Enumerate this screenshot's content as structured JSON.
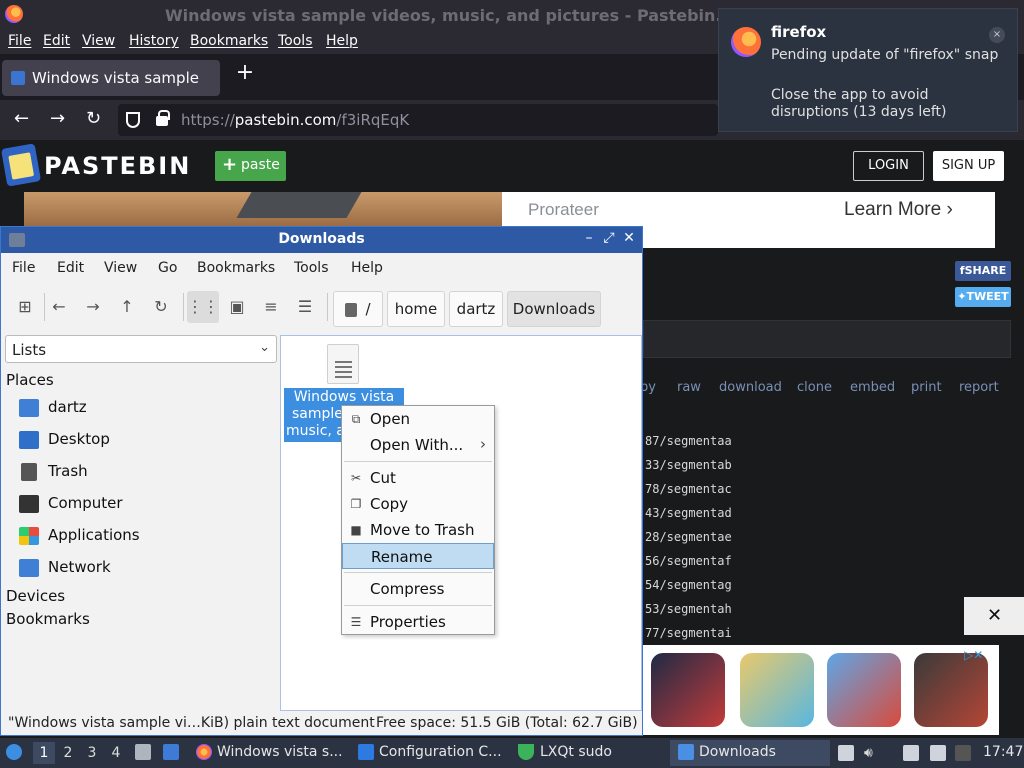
{
  "firefox": {
    "window_title": "Windows vista sample videos, music, and pictures - Pastebin.com",
    "menu": [
      "File",
      "Edit",
      "View",
      "History",
      "Bookmarks",
      "Tools",
      "Help"
    ],
    "tab_title": "Windows vista sample vi",
    "url_prefix": "https://",
    "url_domain": "pastebin.com",
    "url_path": "/f3iRqEqK"
  },
  "notification": {
    "app": "firefox",
    "title": "Pending update of \"firefox\" snap",
    "body": "Close the app to avoid disruptions (13 days left)",
    "close": "×"
  },
  "pastebin": {
    "brand": "PASTEBIN",
    "paste_button": "paste",
    "login": "LOGIN",
    "signup": "SIGN UP",
    "ad_brand": "Prorateer",
    "ad_cta": "Learn More",
    "share_fb": "SHARE",
    "share_tw": "TWEET",
    "actions": [
      "py",
      "raw",
      "download",
      "clone",
      "embed",
      "print",
      "report"
    ],
    "code_lines": [
      "87/segmentaa",
      "33/segmentab",
      "78/segmentac",
      "43/segmentad",
      "28/segmentae",
      "56/segmentaf",
      "54/segmentag",
      "53/segmentah",
      "77/segmentai"
    ]
  },
  "file_manager": {
    "title": "Downloads",
    "menu": [
      "File",
      "Edit",
      "View",
      "Go",
      "Bookmarks",
      "Tools",
      "Help"
    ],
    "path": [
      "/",
      "home",
      "dartz",
      "Downloads"
    ],
    "side_combo": "Lists",
    "places_header": "Places",
    "places": [
      "dartz",
      "Desktop",
      "Trash",
      "Computer",
      "Applications",
      "Network"
    ],
    "devices_header": "Devices",
    "bookmarks_header": "Bookmarks",
    "file_label_lines": [
      "Windows vista",
      "sample",
      "music, a"
    ],
    "status_file": "\"Windows vista sample vi…KiB) plain text document",
    "status_space": "Free space: 51.5 GiB (Total: 62.7 GiB)"
  },
  "context_menu": {
    "items": [
      "Open",
      "Open With...",
      "Cut",
      "Copy",
      "Move to Trash",
      "Rename",
      "Compress",
      "Properties"
    ],
    "highlighted": "Rename"
  },
  "taskbar": {
    "desktops": [
      "1",
      "2",
      "3",
      "4"
    ],
    "tasks": [
      "Windows vista s...",
      "Configuration C...",
      "LXQt sudo",
      "Downloads"
    ],
    "clock": "17:47"
  },
  "colors": {
    "fm_titlebar": "#2e5aa5",
    "selection": "#3b8ee0",
    "paste_green": "#47a54b"
  }
}
